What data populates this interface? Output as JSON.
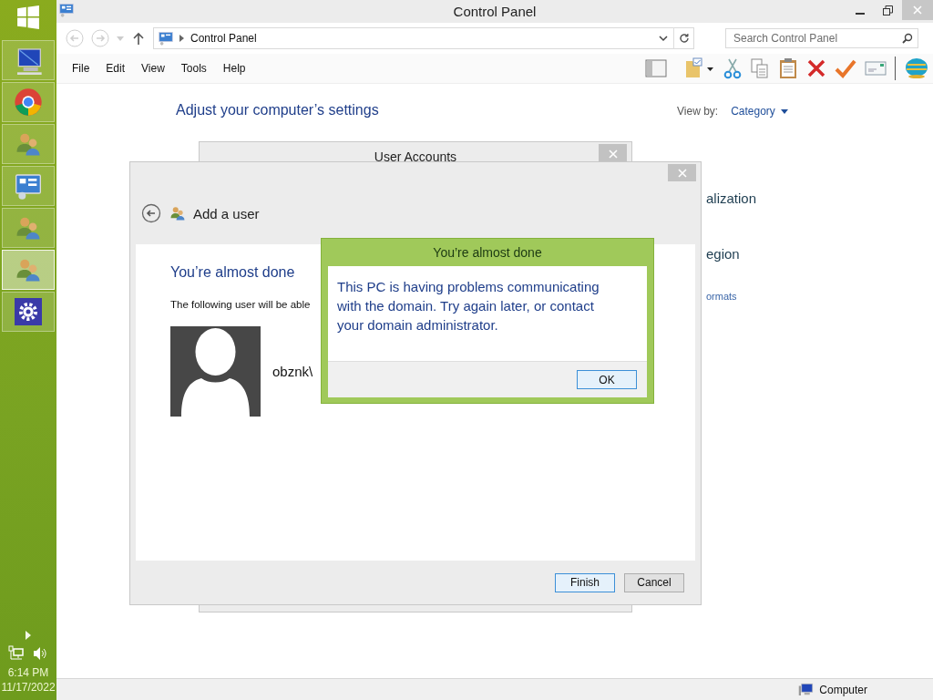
{
  "taskbar": {
    "items": [
      {
        "kind": "computer",
        "selected": false
      },
      {
        "kind": "browser",
        "selected": false
      },
      {
        "kind": "users",
        "selected": false
      },
      {
        "kind": "panel",
        "selected": false
      },
      {
        "kind": "users",
        "selected": false
      },
      {
        "kind": "users",
        "selected": true
      },
      {
        "kind": "settings",
        "selected": false
      }
    ],
    "time": "6:14 PM",
    "date": "11/17/2022"
  },
  "window": {
    "title": "Control Panel"
  },
  "address": {
    "path": "Control Panel"
  },
  "search": {
    "placeholder": "Search Control Panel"
  },
  "menu": [
    "File",
    "Edit",
    "View",
    "Tools",
    "Help"
  ],
  "content": {
    "heading": "Adjust your computer’s settings",
    "view_by_label": "View by:",
    "view_by_value": "Category",
    "partial_items": [
      "alization",
      "egion"
    ],
    "partial_link": "ormats"
  },
  "status_bar": {
    "location": "Computer"
  },
  "user_accounts_dialog": {
    "title": "User Accounts"
  },
  "add_user_dialog": {
    "title": "Add a user",
    "heading": "You’re almost done",
    "description": "The following user will be able",
    "username": "obznk\\",
    "buttons": [
      {
        "label": "Finish",
        "default": true
      },
      {
        "label": "Cancel",
        "default": false
      }
    ]
  },
  "message_box": {
    "title": "You’re almost done",
    "message": "This PC is having problems communicating with the domain. Try again later, or contact your domain administrator.",
    "button": "OK"
  }
}
